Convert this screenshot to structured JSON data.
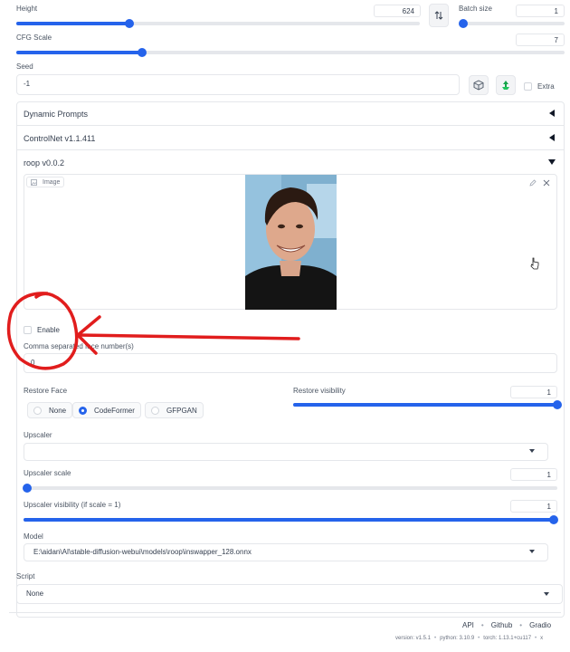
{
  "height": {
    "label": "Height",
    "value": "624",
    "slider_fraction": 0.28
  },
  "swap_icon": "swap-arrows-icon",
  "batch_size": {
    "label": "Batch size",
    "value": "1",
    "slider_fraction": 0.0
  },
  "cfg_scale": {
    "label": "CFG Scale",
    "value": "7",
    "slider_fraction": 0.23
  },
  "seed": {
    "label": "Seed",
    "value": "-1",
    "extra_label": "Extra",
    "extra_checked": false
  },
  "accordions": {
    "dynamic_prompts": "Dynamic Prompts",
    "controlnet": "ControlNet v1.1.411",
    "roop": "roop v0.0.2"
  },
  "roop": {
    "image_label": "Image",
    "enable_label": "Enable",
    "enable_checked": false,
    "face_numbers_label": "Comma separated face number(s)",
    "face_numbers_value": "0",
    "restore_face_label": "Restore Face",
    "restore_face_options": [
      "None",
      "CodeFormer",
      "GFPGAN"
    ],
    "restore_face_selected": "CodeFormer",
    "restore_visibility": {
      "label": "Restore visibility",
      "value": "1",
      "slider_fraction": 1.0
    },
    "upscaler_label": "Upscaler",
    "upscaler_value": "",
    "upscaler_scale": {
      "label": "Upscaler scale",
      "value": "1",
      "slider_fraction": 0.0
    },
    "upscaler_visibility": {
      "label": "Upscaler visibility (if scale = 1)",
      "value": "1",
      "slider_fraction": 1.0
    },
    "model_label": "Model",
    "model_value": "E:\\aidan\\AI\\stable-diffusion-webui\\models\\roop\\inswapper_128.onnx"
  },
  "script": {
    "label": "Script",
    "value": "None"
  },
  "footer": {
    "links": [
      "API",
      "Github",
      "Gradio"
    ],
    "version": "version: v1.5.1",
    "python": "python: 3.10.9",
    "torch": "torch: 1.13.1+cu117",
    "more": "x"
  },
  "colors": {
    "accent": "#2563eb",
    "annotation": "#e11d1d"
  }
}
